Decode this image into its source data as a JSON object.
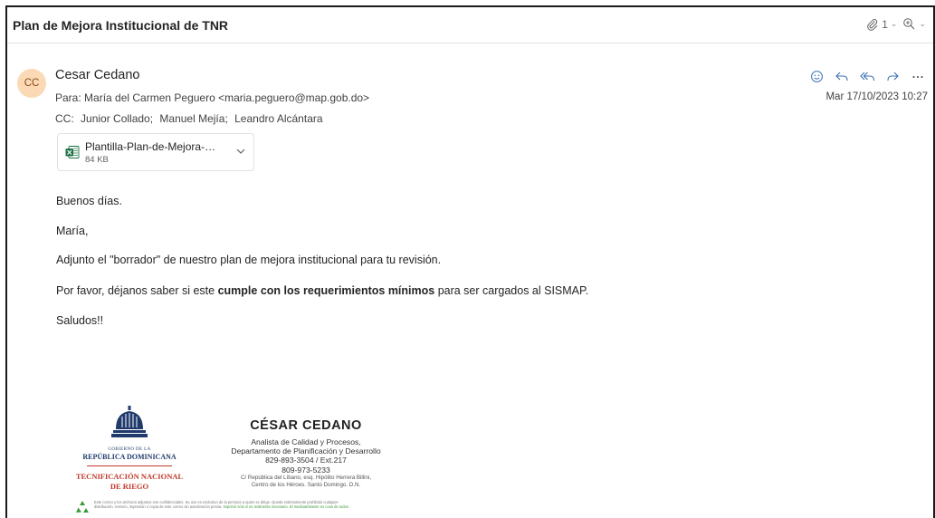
{
  "email": {
    "subject": "Plan de Mejora Institucional de TNR",
    "toolbar": {
      "attachment_count": "1"
    },
    "sender": {
      "initials": "CC",
      "name": "Cesar Cedano"
    },
    "to_label": "Para:",
    "to_value": "María del Carmen Peguero <maria.peguero@map.gob.do>",
    "cc_label": "CC:",
    "cc_recipients": [
      "Junior Collado;",
      "Manuel Mejía;",
      "Leandro Alcántara"
    ],
    "date": "Mar 17/10/2023 10:27",
    "attachment": {
      "name": "Plantilla-Plan-de-Mejora-Vin...",
      "size": "84 KB"
    },
    "body": {
      "greeting": "Buenos días.",
      "name_line": "María,",
      "para1": "Adjunto el \"borrador\" de nuestro plan de mejora institucional para tu revisión.",
      "para2_pre": "Por favor, déjanos saber si este ",
      "para2_bold": "cumple con los requerimientos mínimos",
      "para2_post": " para ser cargados al SISMAP.",
      "closing": "Saludos!!"
    },
    "signature": {
      "logo_gob": "GOBIERNO DE LA",
      "logo_rep": "REPÚBLICA DOMINICANA",
      "logo_tec1": "TECNIFICACIÓN NACIONAL",
      "logo_tec2": "DE RIEGO",
      "name": "CÉSAR CEDANO",
      "title": "Analista de Calidad y Procesos,",
      "department": "Departamento de Planificación y Desarrollo",
      "phone1": "829-893-3504 / Ext.217",
      "phone2": "809-973-5233",
      "address1": "C/ República del Líbano, esq. Hipólito Herrera Billini,",
      "address2": "Centro de los Héroes. Santo Domingo. D.N.",
      "disclaimer_1": "Este correo y los archivos adjuntos son confidenciales. Su uso es exclusivo de la persona a quien se dirige. Queda estrictamente prohibido cualquier",
      "disclaimer_2": "distribución, reenvío, impresión o copia de este correo sin autorización previa. ",
      "disclaimer_green": "Imprimir sólo si es realmente necesario. El medioambiente es cosa de todos."
    }
  },
  "colors": {
    "avatar_bg": "#fbd9b5",
    "avatar_text": "#8a4a13",
    "action_blue": "#3a6fb5",
    "brand_navy": "#1f3a6b",
    "brand_red": "#c0392b",
    "excel_green": "#1e7145"
  },
  "icons": [
    "paperclip-icon",
    "zoom-icon",
    "emoji-icon",
    "reply-icon",
    "reply-all-icon",
    "forward-icon",
    "more-icon",
    "excel-icon",
    "chevron-down-icon",
    "emblem-icon",
    "recycle-icon"
  ]
}
